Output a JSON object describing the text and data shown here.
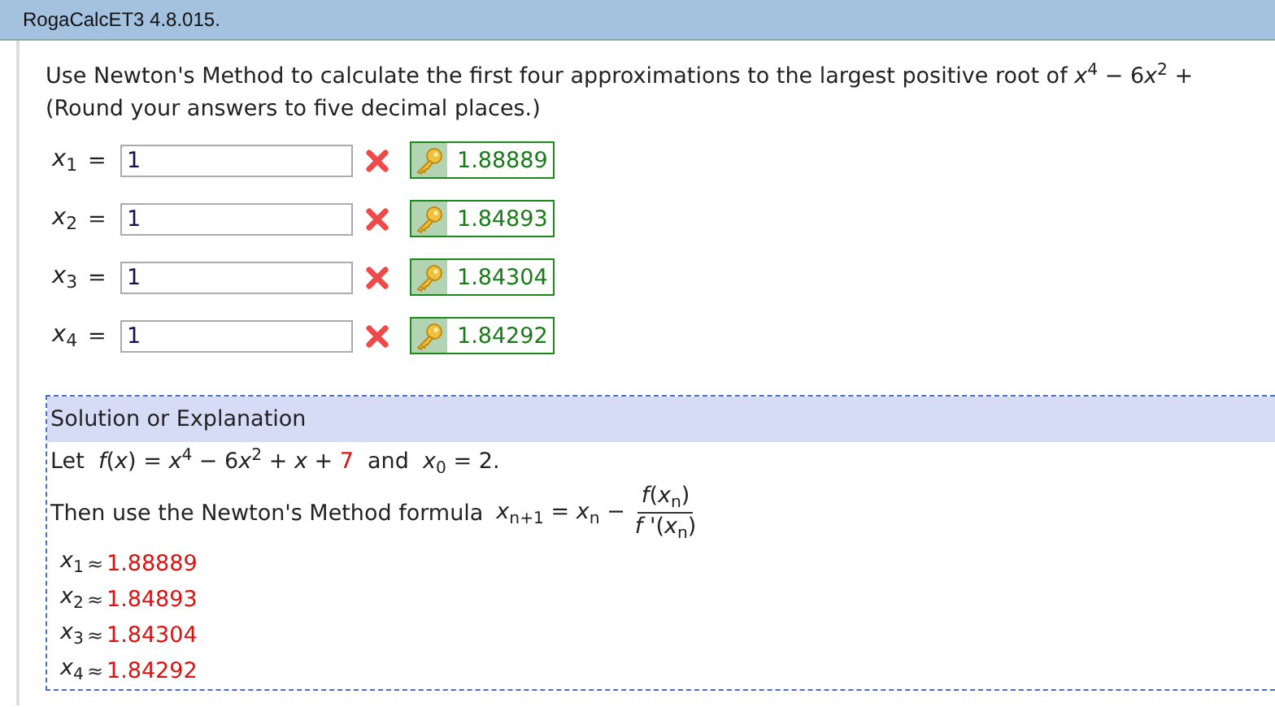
{
  "window": {
    "title": "RogaCalcET3 4.8.015."
  },
  "question": {
    "lines": [
      [
        "Use Newton's Method to calculate the first four approximations to the largest positive root of  ",
        "*x*$^{4}$ − 6",
        "*x*$^{2}$ +"
      ],
      [
        "(Round your answers to five decimal places.)"
      ]
    ]
  },
  "answers": [
    {
      "label": "*x*$_{1}$",
      "equals": "=",
      "value": "1",
      "correct": false,
      "key": "1.88889"
    },
    {
      "label": "*x*$_{2}$",
      "equals": "=",
      "value": "1",
      "correct": false,
      "key": "1.84893"
    },
    {
      "label": "*x*$_{3}$",
      "equals": "=",
      "value": "1",
      "correct": false,
      "key": "1.84304"
    },
    {
      "label": "*x*$_{4}$",
      "equals": "=",
      "value": "1",
      "correct": false,
      "key": "1.84292"
    }
  ],
  "solution": {
    "title": "Solution or Explanation",
    "let_line": [
      {
        "text": "Let  *f*(*x*) = *x*$^{4}$ − 6",
        "highlight": false
      },
      {
        "text": "*x*$^{2}$ + *x* + ",
        "highlight": false
      },
      {
        "text": "7",
        "highlight": true
      },
      {
        "text": "  and  *x*$_{0}$ = 2.",
        "highlight": false
      }
    ],
    "formula_intro": "Then use the Newton's Method formula",
    "formula_lhs": "*x*$_{n+1}$ = *x*$_{n}$ −",
    "numerator": "*f*(*x*$_{n}$)",
    "denominator": "*f* '(*x*$_{n}$)",
    "approximations": [
      {
        "label": "*x*$_{1}$",
        "symbol": "≈",
        "value": "1.88889"
      },
      {
        "label": "*x*$_{2}$",
        "symbol": "≈",
        "value": "1.84893"
      },
      {
        "label": "*x*$_{3}$",
        "symbol": "≈",
        "value": "1.84304"
      },
      {
        "label": "*x*$_{4}$",
        "symbol": "≈",
        "value": "1.84292"
      }
    ]
  }
}
